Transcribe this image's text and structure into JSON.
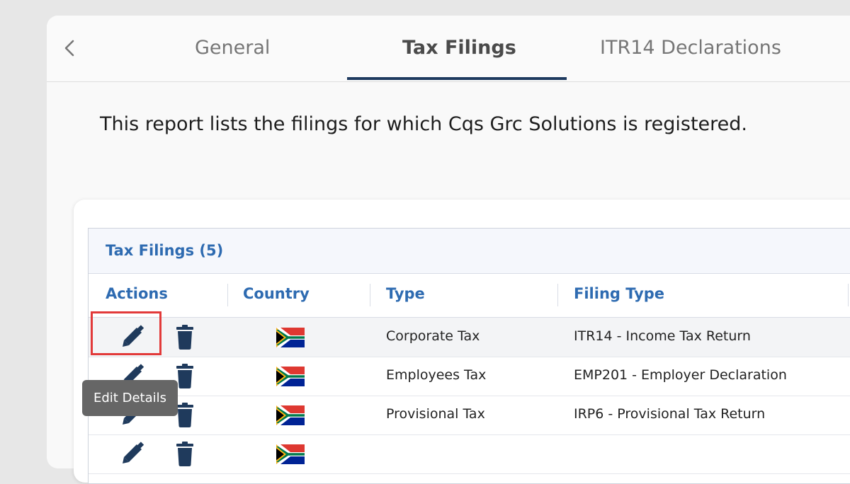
{
  "nav": {
    "tabs": [
      {
        "label": "General",
        "active": false
      },
      {
        "label": "Tax Filings",
        "active": true
      },
      {
        "label": "ITR14 Declarations",
        "active": false
      }
    ]
  },
  "description": "This report lists the filings for which Cqs Grc Solutions is registered.",
  "table": {
    "title": "Tax Filings (5)",
    "columns": [
      "Actions",
      "Country",
      "Type",
      "Filing Type"
    ],
    "rows": [
      {
        "type": "Corporate Tax",
        "filing_type": "ITR14 - Income Tax Return",
        "country_flag": "south-africa-flag"
      },
      {
        "type": "Employees Tax",
        "filing_type": "EMP201 - Employer Declaration",
        "country_flag": "south-africa-flag"
      },
      {
        "type": "Provisional Tax",
        "filing_type": "IRP6 - Provisional Tax Return",
        "country_flag": "south-africa-flag"
      },
      {
        "type": "",
        "filing_type": "",
        "country_flag": "south-africa-flag"
      }
    ]
  },
  "tooltip": "Edit Details",
  "colors": {
    "accent": "#2e6bb1",
    "tab_underline": "#1e3a5f",
    "icon": "#1f3a5c",
    "focus_highlight": "#e23a3a"
  }
}
